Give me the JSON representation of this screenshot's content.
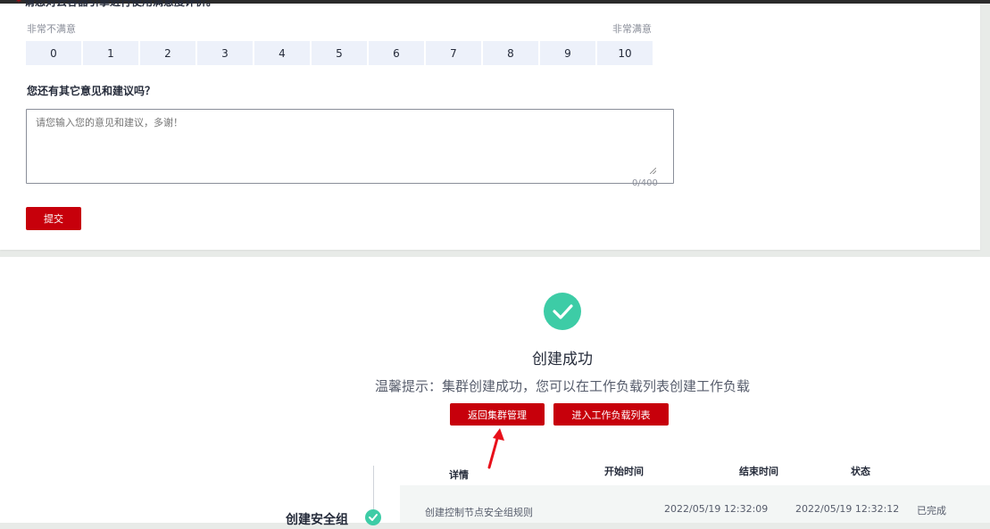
{
  "survey": {
    "required_mark": "*",
    "question_1": "请您对云容器引擎进行使用满意度评价。",
    "scale_low_label": "非常不满意",
    "scale_high_label": "非常满意",
    "scores": [
      "0",
      "1",
      "2",
      "3",
      "4",
      "5",
      "6",
      "7",
      "8",
      "9",
      "10"
    ],
    "question_2": "您还有其它意见和建议吗？",
    "feedback_placeholder": "请您输入您的意见和建议，多谢！",
    "char_count": "0/400",
    "submit_label": "提交"
  },
  "result": {
    "title": "创建成功",
    "hint": "温馨提示：集群创建成功，您可以在工作负载列表创建工作负载",
    "back_button_label": "返回集群管理",
    "workload_button_label": "进入工作负载列表",
    "success_color": "#3dcca6",
    "accent_color": "#c7000b"
  },
  "task_table": {
    "columns": {
      "detail": "详情",
      "start": "开始时间",
      "end": "结束时间",
      "status": "状态"
    },
    "rows": [
      {
        "detail": "创建控制节点安全组规则",
        "start": "2022/05/19 12:32:09",
        "end": "2022/05/19 12:32:12",
        "status": "已完成"
      }
    ],
    "step_label": "创建安全组"
  },
  "icons": {
    "success": "check-circle-icon",
    "annotation": "red-arrow-icon"
  }
}
